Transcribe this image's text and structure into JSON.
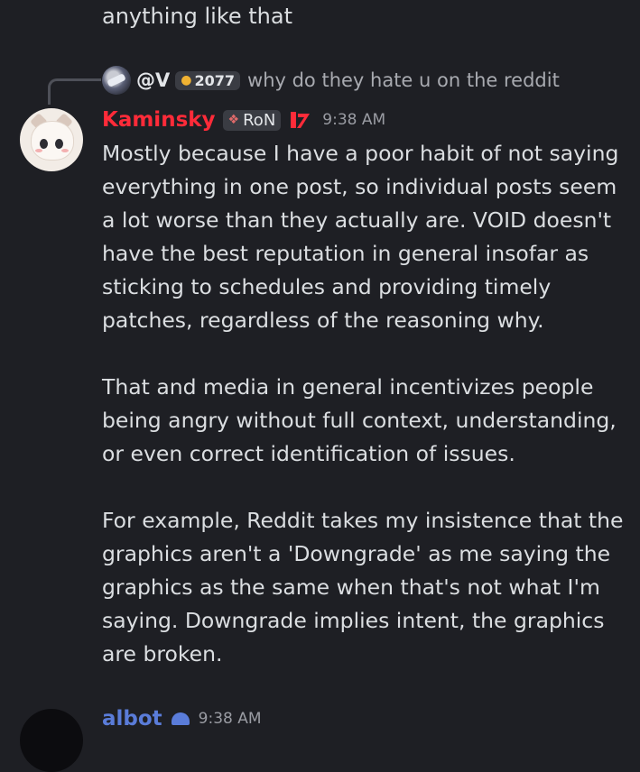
{
  "previous_message": {
    "tail_text": "anything like that"
  },
  "reply": {
    "username": "@V",
    "badge_count": "2077",
    "text": "why do they hate u on the reddit"
  },
  "message": {
    "username": "Kaminsky",
    "username_color": "#ff2b39",
    "role_tag": "RoN",
    "timestamp": "9:38 AM",
    "paragraphs": [
      "Mostly because I have a poor habit of not saying everything in one post, so individual posts seem a lot worse than they actually are. VOID doesn't have the best reputation in general insofar as sticking to schedules and providing timely patches, regardless of the reasoning why.",
      "That and media in general incentivizes people being angry without full context, understanding, or even correct identification of issues.",
      "For example, Reddit takes my insistence that the graphics aren't a 'Downgrade' as me saying the graphics as the same when that's not what I'm saying. Downgrade implies intent, the graphics are broken."
    ]
  },
  "next_message": {
    "username": "albot",
    "timestamp": "9:38 AM"
  }
}
